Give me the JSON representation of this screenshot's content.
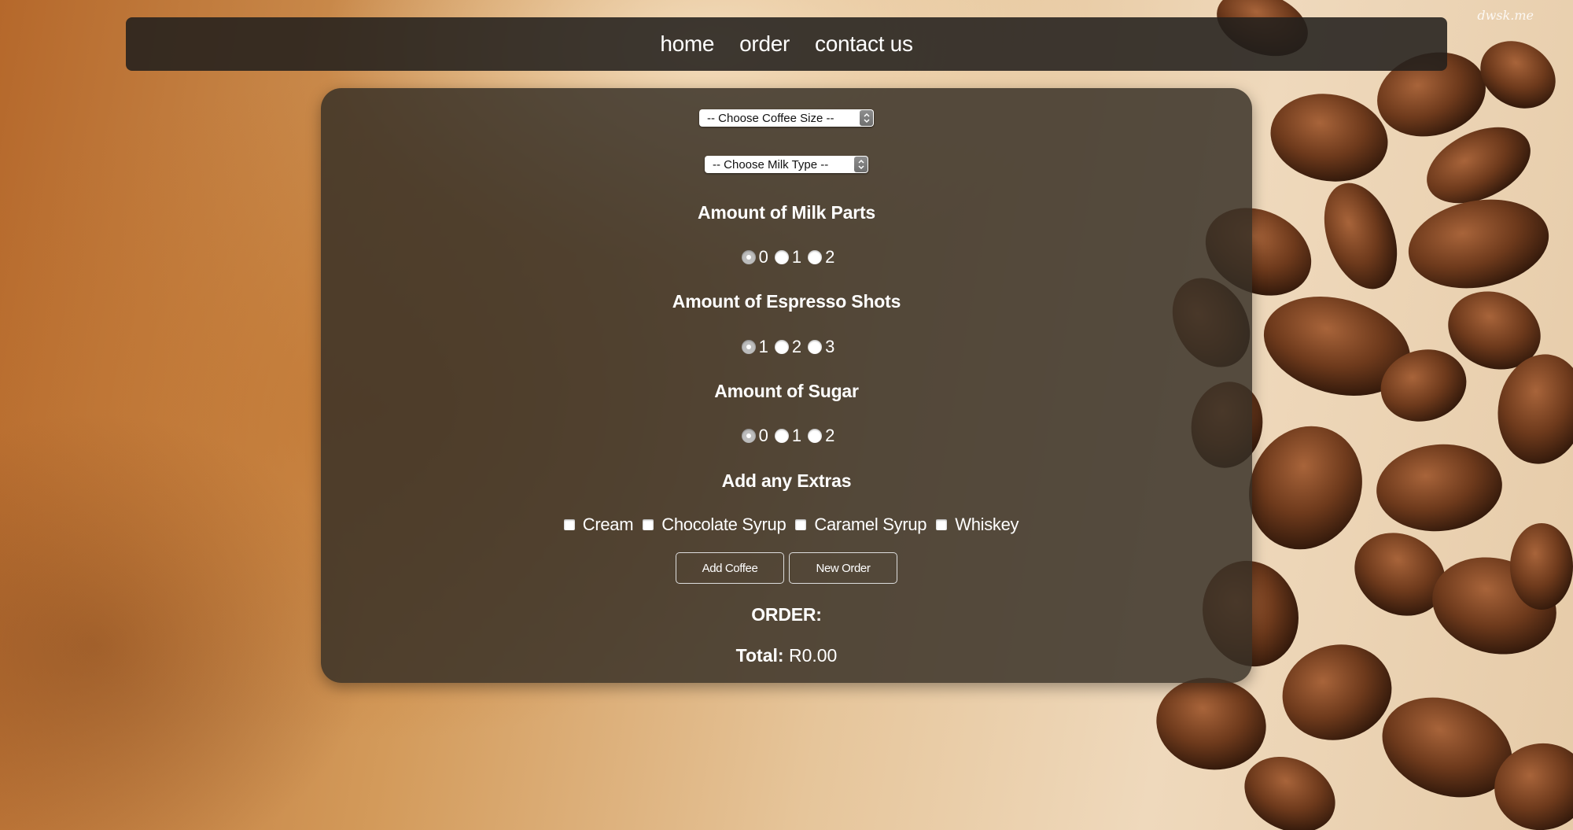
{
  "watermark": "dwsk.me",
  "nav": {
    "home": "home",
    "order": "order",
    "contact": "contact us"
  },
  "form": {
    "coffee_size": {
      "placeholder": "-- Choose Coffee Size --"
    },
    "milk_type": {
      "placeholder": "-- Choose Milk Type --"
    },
    "milk_parts": {
      "heading": "Amount of Milk Parts",
      "options": [
        "0",
        "1",
        "2"
      ],
      "selected": "0"
    },
    "espresso_shots": {
      "heading": "Amount of Espresso Shots",
      "options": [
        "1",
        "2",
        "3"
      ],
      "selected": "1"
    },
    "sugar": {
      "heading": "Amount of Sugar",
      "options": [
        "0",
        "1",
        "2"
      ],
      "selected": "0"
    },
    "extras": {
      "heading": "Add any Extras",
      "options": [
        "Cream",
        "Chocolate Syrup",
        "Caramel Syrup",
        "Whiskey"
      ]
    },
    "add_coffee_label": "Add Coffee",
    "new_order_label": "New Order"
  },
  "order": {
    "heading": "ORDER:",
    "total_label": "Total:",
    "total_value": "R0.00"
  }
}
